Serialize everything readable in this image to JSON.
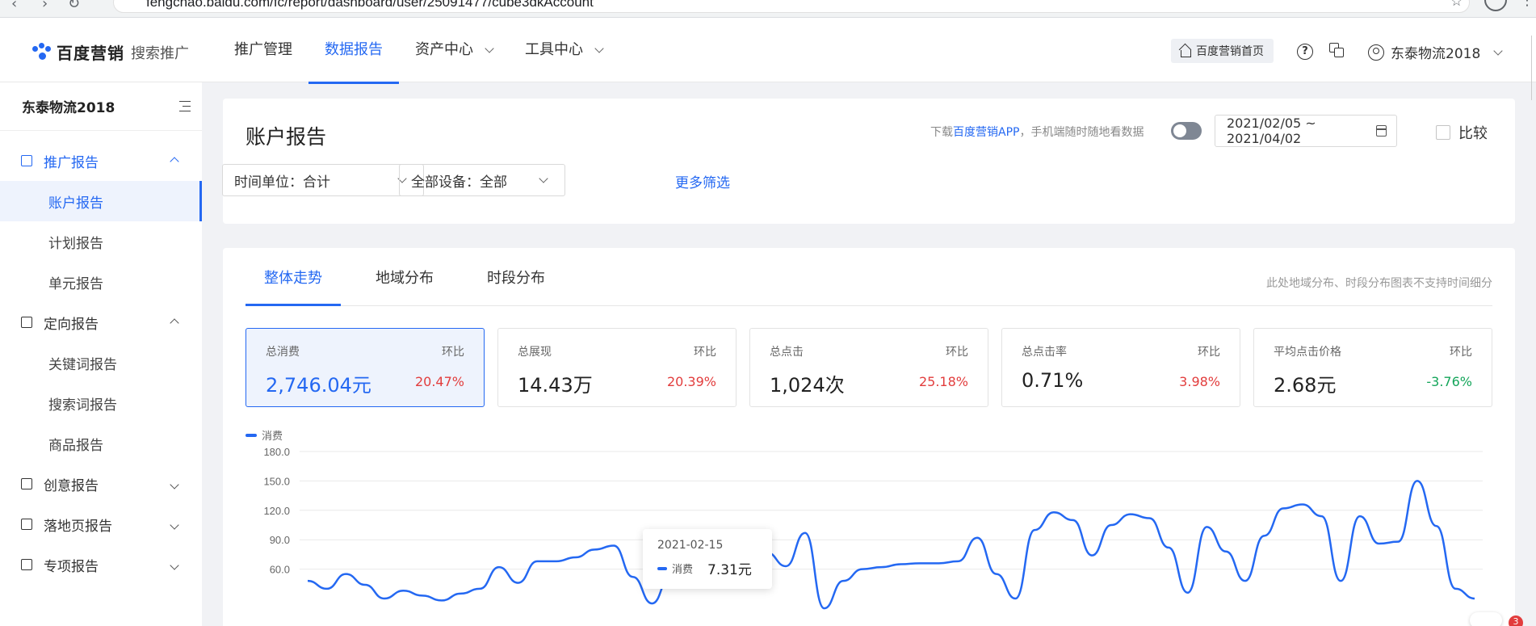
{
  "browser": {
    "url": "fengchao.baidu.com/fc/report/dashboard/user/25091477/cube3dkAccount"
  },
  "header": {
    "brand": "百度营销",
    "sub_brand": "搜索推广",
    "nav": [
      {
        "label": "推广管理",
        "active": false,
        "dropdown": false
      },
      {
        "label": "数据报告",
        "active": true,
        "dropdown": false
      },
      {
        "label": "资产中心",
        "active": false,
        "dropdown": true
      },
      {
        "label": "工具中心",
        "active": false,
        "dropdown": true
      }
    ],
    "home_label": "百度营销首页",
    "help_icon": "?",
    "user_name": "东泰物流2018"
  },
  "sidebar": {
    "account": "东泰物流2018",
    "groups": [
      {
        "label": "推广报告",
        "open": true,
        "items": [
          "账户报告",
          "计划报告",
          "单元报告"
        ]
      },
      {
        "label": "定向报告",
        "open": true,
        "items": [
          "关键词报告",
          "搜索词报告",
          "商品报告"
        ]
      },
      {
        "label": "创意报告",
        "open": false,
        "items": []
      },
      {
        "label": "落地页报告",
        "open": false,
        "items": []
      },
      {
        "label": "专项报告",
        "open": false,
        "items": []
      }
    ],
    "active_item": "账户报告"
  },
  "filters": {
    "title": "账户报告",
    "promo_prefix": "下载",
    "promo_link": "百度营销APP",
    "promo_suffix": "，手机端随时随地看数据",
    "date_range": "2021/02/05 ~ 2021/04/02",
    "compare_label": "比较",
    "time_unit": "时间单位：合计",
    "device": "全部设备：全部",
    "more_filters": "更多筛选"
  },
  "tabs": {
    "items": [
      "整体走势",
      "地域分布",
      "时段分布"
    ],
    "active": "整体走势",
    "note": "此处地域分布、时段分布图表不支持时间细分"
  },
  "metrics": [
    {
      "label": "总消费",
      "compare_label": "环比",
      "value": "2,746.04元",
      "change": "20.47%",
      "direction": "up",
      "active": true
    },
    {
      "label": "总展现",
      "compare_label": "环比",
      "value": "14.43万",
      "change": "20.39%",
      "direction": "up",
      "active": false
    },
    {
      "label": "总点击",
      "compare_label": "环比",
      "value": "1,024次",
      "change": "25.18%",
      "direction": "up",
      "active": false
    },
    {
      "label": "总点击率",
      "compare_label": "环比",
      "value": "0.71%",
      "change": "3.98%",
      "direction": "up",
      "active": false
    },
    {
      "label": "平均点击价格",
      "compare_label": "环比",
      "value": "2.68元",
      "change": "-3.76%",
      "direction": "down",
      "active": false
    }
  ],
  "chart_data": {
    "type": "line",
    "series": [
      {
        "name": "消费",
        "values": [
          48,
          40,
          55,
          44,
          30,
          38,
          33,
          28,
          35,
          40,
          62,
          46,
          68,
          68,
          72,
          80,
          84,
          52,
          25,
          55,
          62,
          58,
          72,
          80,
          77,
          63,
          97,
          20,
          48,
          60,
          62,
          65,
          66,
          66,
          68,
          92,
          55,
          30,
          100,
          118,
          110,
          74,
          105,
          116,
          112,
          82,
          36,
          103,
          78,
          48,
          94,
          122,
          126,
          114,
          48,
          114,
          86,
          88,
          150,
          104,
          40,
          30
        ]
      }
    ],
    "y_ticks": [
      "180.0",
      "150.0",
      "120.0",
      "90.0",
      "60.0"
    ],
    "ylim": [
      0,
      180
    ],
    "color": "#2468f2",
    "tooltip": {
      "date": "2021-02-15",
      "series": "消费",
      "value": "7.31元"
    }
  },
  "colors": {
    "accent": "#2468f2",
    "positive": "#e23d3d",
    "negative": "#14a55a"
  },
  "notification_count": "3"
}
